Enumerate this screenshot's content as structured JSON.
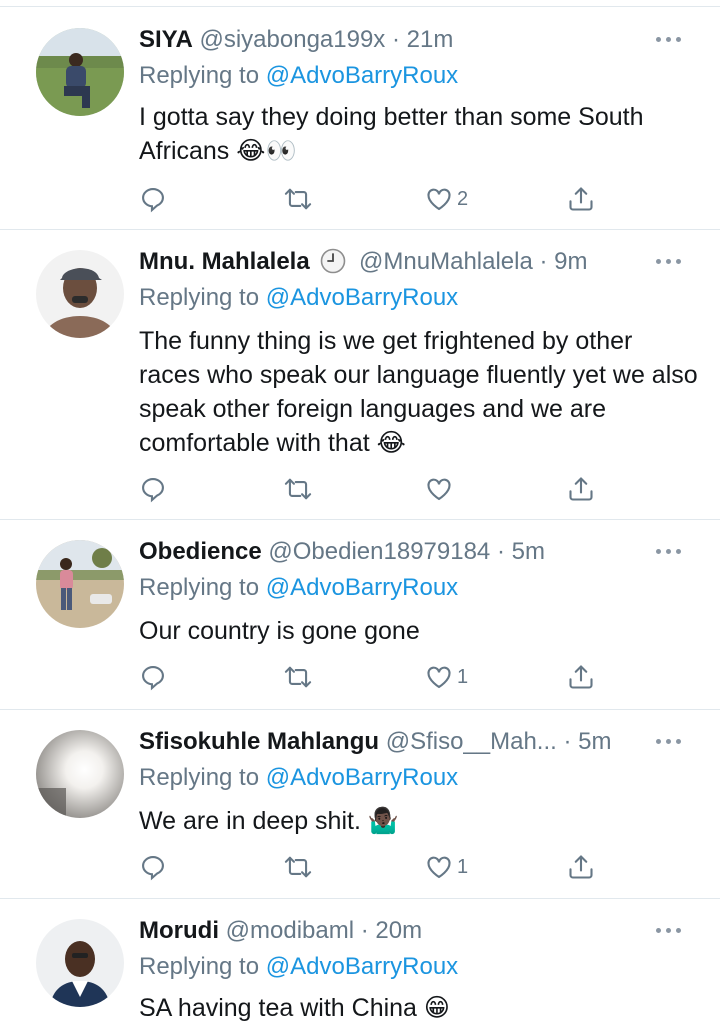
{
  "tweets": [
    {
      "name": "SIYA",
      "handle": "@siyabonga199x",
      "time": "21m",
      "replying_label": "Replying to",
      "replying_to": "@AdvoBarryRoux",
      "text": "I gotta say they doing better than some South Africans 😂👀",
      "like_count": "2",
      "avatar": "person-outdoors-avatar"
    },
    {
      "name": "Mnu. Mahlalela",
      "handle": "@MnuMahlalela",
      "time": "9m",
      "replying_label": "Replying to",
      "replying_to": "@AdvoBarryRoux",
      "text": "The funny thing is we get frightened by other races who speak our language fluently yet we also speak other foreign languages and we are comfortable with that 😂",
      "like_count": "",
      "avatar": "man-with-cap-avatar"
    },
    {
      "name": "Obedience",
      "handle": "@Obedien18979184",
      "time": "5m",
      "replying_label": "Replying to",
      "replying_to": "@AdvoBarryRoux",
      "text": "Our country is gone gone",
      "like_count": "1",
      "avatar": "person-field-avatar"
    },
    {
      "name": "Sfisokuhle Mahlangu",
      "handle": "@Sfiso__Mah...",
      "time": "5m",
      "replying_label": "Replying to",
      "replying_to": "@AdvoBarryRoux",
      "text": "We are in deep shit. 🤷🏿‍♂️",
      "like_count": "1",
      "avatar": "bright-light-avatar"
    },
    {
      "name": "Morudi",
      "handle": "@modibaml",
      "time": "20m",
      "replying_label": "Replying to",
      "replying_to": "@AdvoBarryRoux",
      "text": "SA having tea with China 😁",
      "like_count": "",
      "avatar": "man-in-suit-avatar"
    }
  ],
  "separator": "·",
  "colors": {
    "link": "#1b95e0",
    "secondary_text": "#657786",
    "divider": "#e1e8ed",
    "icon": "#657786"
  },
  "icons": [
    "reply-icon",
    "retweet-icon",
    "like-icon",
    "share-icon",
    "more-icon",
    "clock-icon"
  ]
}
